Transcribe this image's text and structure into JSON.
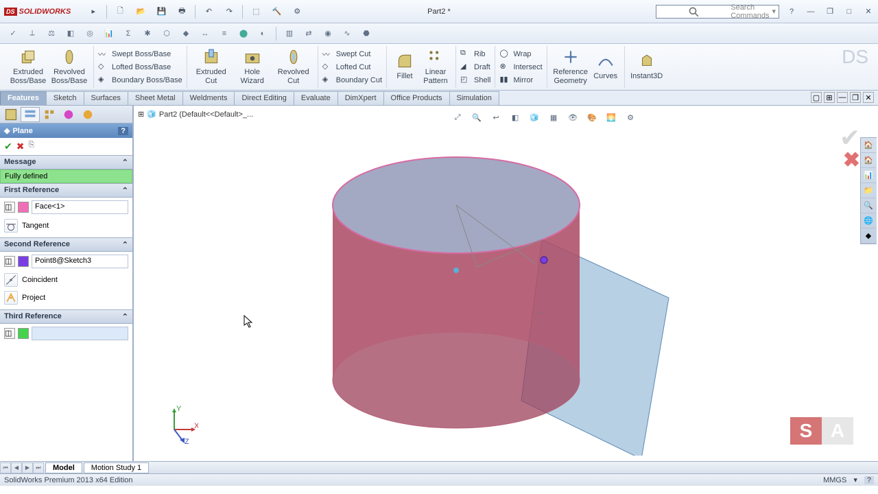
{
  "app": {
    "name": "SOLIDWORKS",
    "doc_title": "Part2 *",
    "search_placeholder": "Search Commands"
  },
  "ribbon": {
    "big": {
      "extruded_boss": "Extruded Boss/Base",
      "revolved_boss": "Revolved Boss/Base",
      "extruded_cut": "Extruded Cut",
      "hole_wizard": "Hole Wizard",
      "revolved_cut": "Revolved Cut",
      "fillet": "Fillet",
      "linear_pattern": "Linear Pattern",
      "reference_geometry": "Reference Geometry",
      "curves": "Curves",
      "instant3d": "Instant3D"
    },
    "list1": {
      "swept_boss": "Swept Boss/Base",
      "lofted_boss": "Lofted Boss/Base",
      "boundary_boss": "Boundary Boss/Base"
    },
    "list2": {
      "swept_cut": "Swept Cut",
      "lofted_cut": "Lofted Cut",
      "boundary_cut": "Boundary Cut"
    },
    "list3": {
      "rib": "Rib",
      "draft": "Draft",
      "shell": "Shell"
    },
    "list4": {
      "wrap": "Wrap",
      "intersect": "Intersect",
      "mirror": "Mirror"
    }
  },
  "tabs": [
    "Features",
    "Sketch",
    "Surfaces",
    "Sheet Metal",
    "Weldments",
    "Direct Editing",
    "Evaluate",
    "DimXpert",
    "Office Products",
    "Simulation"
  ],
  "active_tab": "Features",
  "pm": {
    "title": "Plane",
    "message_label": "Message",
    "status": "Fully defined",
    "ref1": {
      "label": "First Reference",
      "value": "Face<1>",
      "opt": "Tangent",
      "swatch": "#f06fb7"
    },
    "ref2": {
      "label": "Second Reference",
      "value": "Point8@Sketch3",
      "opt1": "Coincident",
      "opt2": "Project",
      "swatch": "#7a3fe3"
    },
    "ref3": {
      "label": "Third Reference",
      "value": "",
      "swatch": "#45d34e"
    }
  },
  "breadcrumb": "Part2  (Default<<Default>_...",
  "bottom_tabs": [
    "Model",
    "Motion Study 1"
  ],
  "status": {
    "edition": "SolidWorks Premium 2013 x64 Edition",
    "units": "MMGS"
  }
}
